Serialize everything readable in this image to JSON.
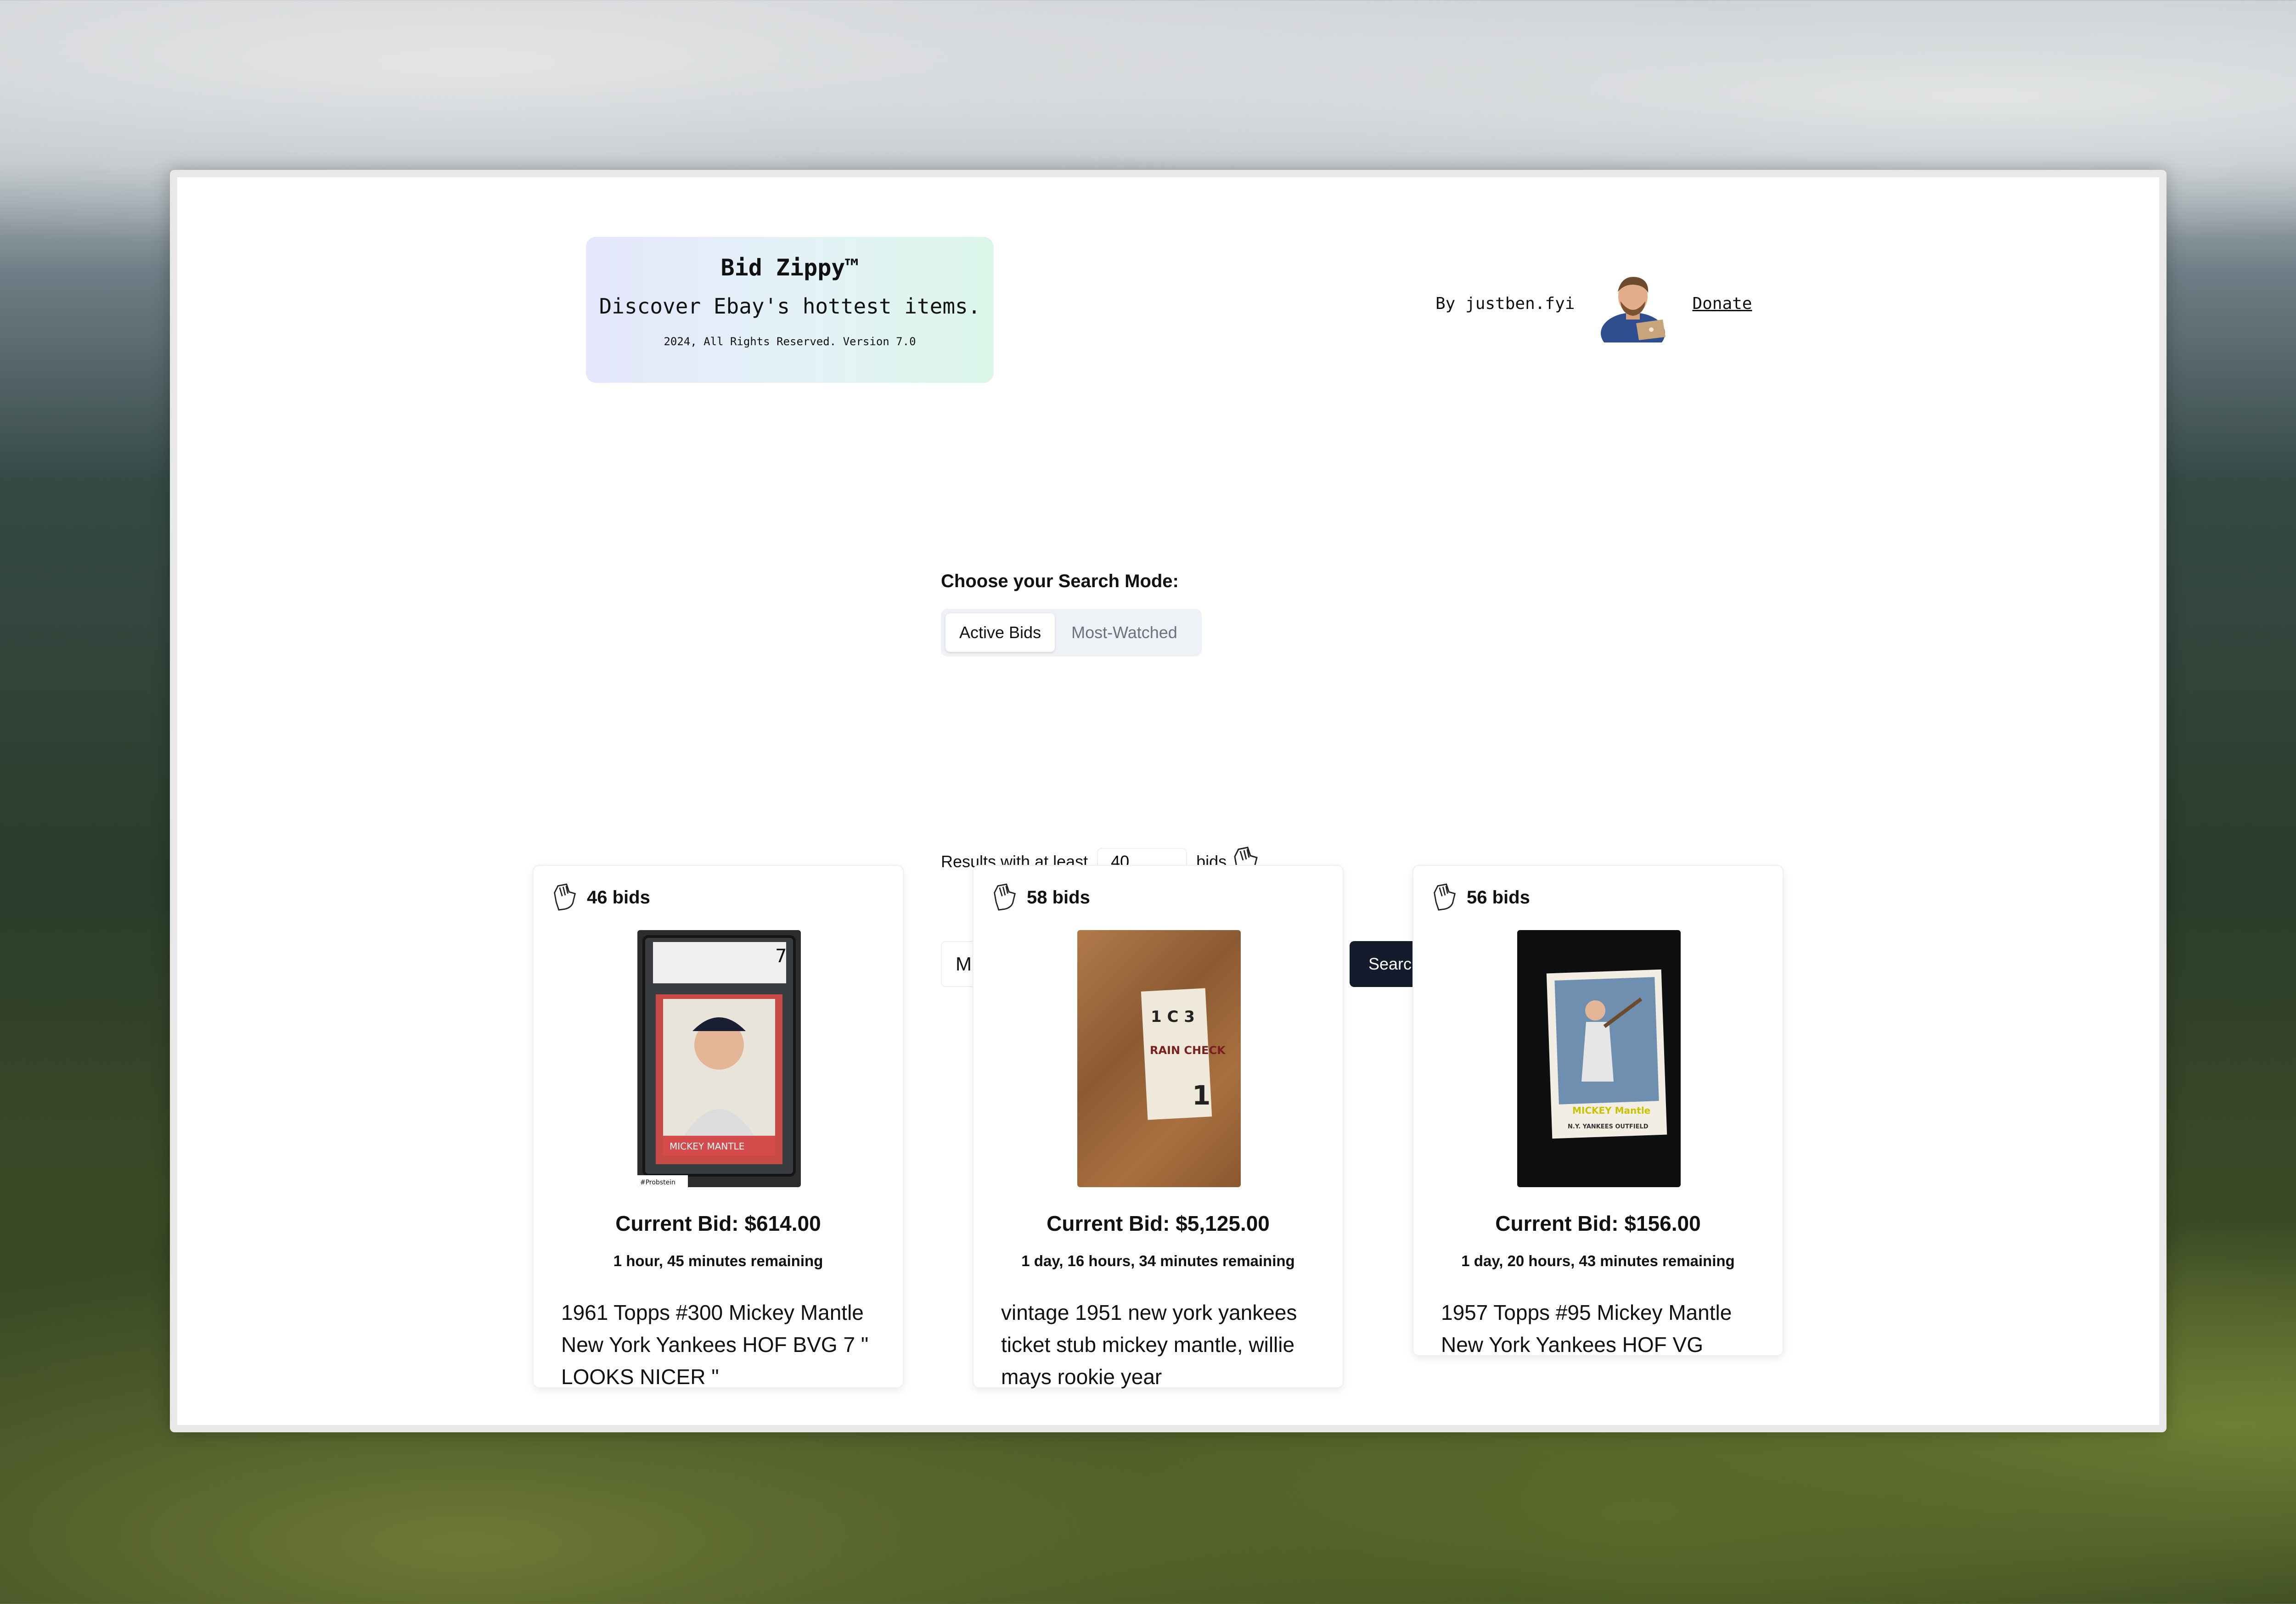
{
  "brand": {
    "name": "Bid Zippy™",
    "tagline": "Discover Ebay's hottest items.",
    "footer": "2024, All Rights Reserved. Version 7.0"
  },
  "author": {
    "byline": "By justben.fyi",
    "donate_label": "Donate"
  },
  "search_mode": {
    "label": "Choose your Search Mode:",
    "options": [
      "Active Bids",
      "Most-Watched"
    ],
    "selected": "Active Bids"
  },
  "min_bids": {
    "prefix": "Results with at least",
    "value": "40",
    "suffix": "bids"
  },
  "search": {
    "query": "Mickey Mantle",
    "button_label": "Search eBay",
    "clear_icon": "✕"
  },
  "results": [
    {
      "bids": "46 bids",
      "current_bid": "Current Bid: $614.00",
      "remaining": "1 hour, 45 minutes remaining",
      "title": "1961 Topps #300 Mickey Mantle New York Yankees HOF BVG 7 \" LOOKS NICER \"",
      "photo_caption": "MICKEY MANTLE",
      "photo_tag": "#Probstein",
      "photo_grade": "7"
    },
    {
      "bids": "58 bids",
      "current_bid": "Current Bid: $5,125.00",
      "remaining": "1 day, 16 hours, 34 minutes remaining",
      "title": "vintage 1951 new york yankees ticket stub mickey mantle, willie mays rookie year",
      "photo_caption": "RAIN CHECK",
      "photo_code": "1 C 3",
      "photo_number": "1"
    },
    {
      "bids": "56 bids",
      "current_bid": "Current Bid: $156.00",
      "remaining": "1 day, 20 hours, 43 minutes remaining",
      "title": "1957 Topps #95 Mickey Mantle New York Yankees HOF VG",
      "photo_caption": "MICKEY Mantle",
      "photo_sub": "N.Y. YANKEES OUTFIELD"
    }
  ],
  "colors": {
    "button": "#141b2d",
    "card_border": "#eef0f3",
    "toggle_bg": "#eef1f5"
  },
  "icons": [
    "hand-bid-icon",
    "close-icon",
    "avatar"
  ]
}
